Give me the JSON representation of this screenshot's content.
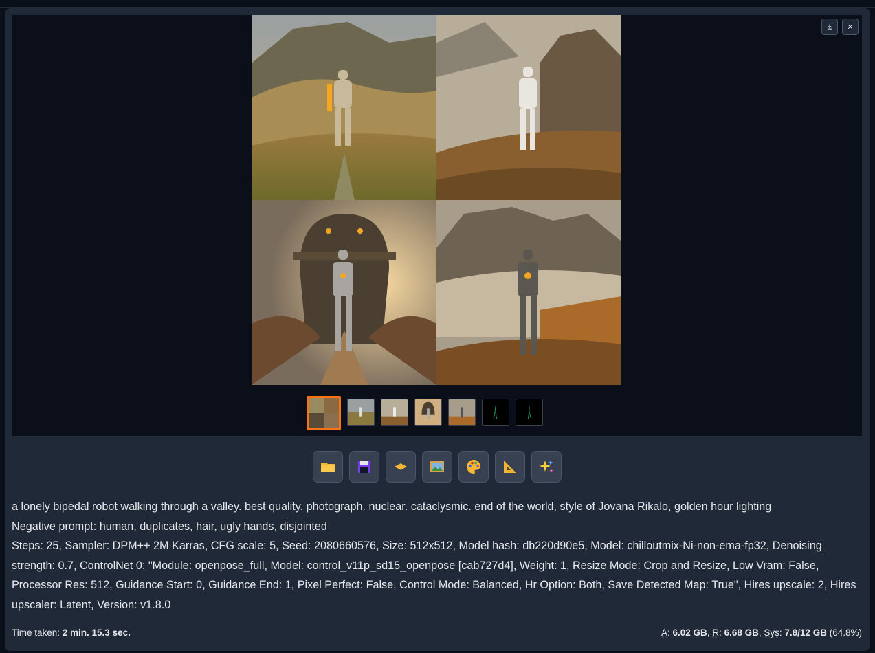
{
  "toolbar_icons": [
    "folder-icon",
    "save-icon",
    "zip-icon",
    "image-icon",
    "palette-icon",
    "ruler-icon",
    "sparkles-icon"
  ],
  "gallery": {
    "download_label": "download-icon",
    "close_label": "close-icon",
    "thumbnail_count": 7,
    "selected_thumbnail": 0
  },
  "info": {
    "prompt": "a lonely bipedal robot walking through a valley. best quality. photograph. nuclear. cataclysmic. end of the world, style of Jovana Rikalo, golden hour lighting",
    "negative_prompt": "Negative prompt: human, duplicates, hair, ugly hands, disjointed",
    "params": "Steps: 25, Sampler: DPM++ 2M Karras, CFG scale: 5, Seed: 2080660576, Size: 512x512, Model hash: db220d90e5, Model: chilloutmix-Ni-non-ema-fp32, Denoising strength: 0.7, ControlNet 0: \"Module: openpose_full, Model: control_v11p_sd15_openpose [cab727d4], Weight: 1, Resize Mode: Crop and Resize, Low Vram: False, Processor Res: 512, Guidance Start: 0, Guidance End: 1, Pixel Perfect: False, Control Mode: Balanced, Hr Option: Both, Save Detected Map: True\", Hires upscale: 2, Hires upscaler: Latent, Version: v1.8.0"
  },
  "footer": {
    "time_label": "Time taken: ",
    "time_value": "2 min. 15.3 sec.",
    "a_label": "A",
    "a_value": "6.02 GB",
    "r_label": "R",
    "r_value": "6.68 GB",
    "sys_label": "Sys",
    "sys_value": "7.8/12 GB",
    "sys_pct": "(64.8%)"
  },
  "colors": {
    "accent": "#f97316",
    "background": "#0b0f19",
    "panel": "#1f2937"
  }
}
